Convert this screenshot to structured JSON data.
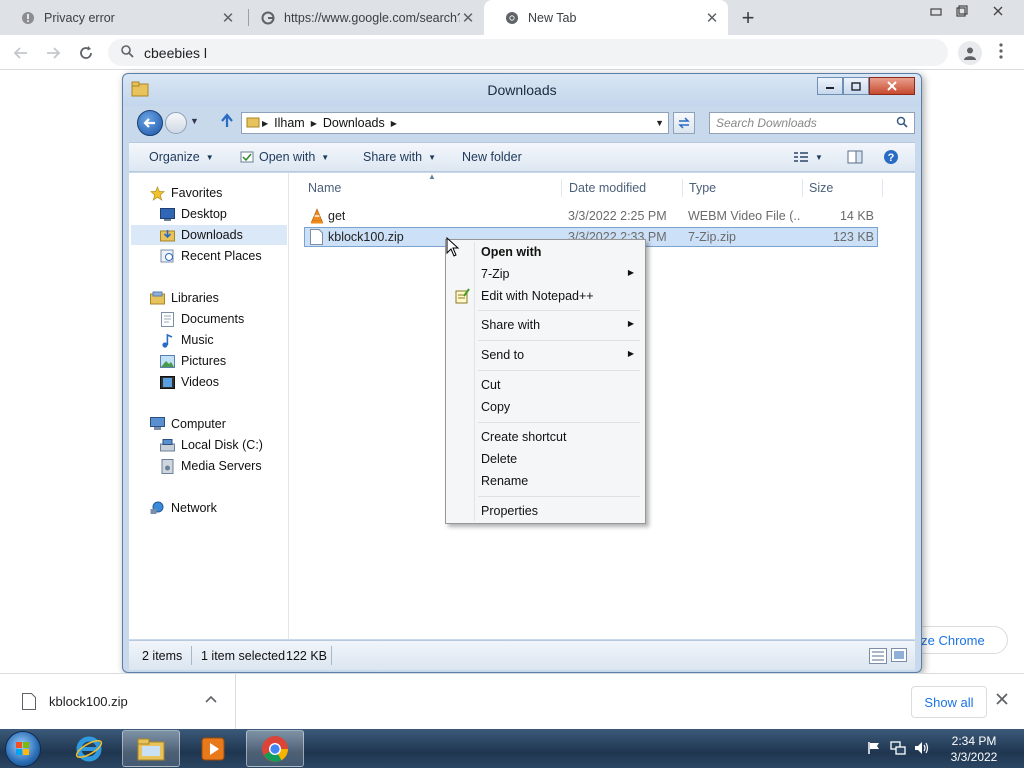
{
  "browser": {
    "tabs": [
      {
        "label": "Privacy error",
        "icon": "warning-icon"
      },
      {
        "label": "https://www.google.com/search?",
        "icon": "google-icon"
      },
      {
        "label": "New Tab",
        "icon": "chrome-icon"
      }
    ],
    "new_tab_symbol": "+",
    "close_symbol": "✕",
    "omnibox_text": "cbeebies l",
    "customize_label": "nize Chrome"
  },
  "explorer": {
    "title": "Downloads",
    "path": [
      "Ilham",
      "Downloads"
    ],
    "search_placeholder": "Search Downloads",
    "commands": {
      "organize": "Organize",
      "open_with": "Open with",
      "share_with": "Share with",
      "new_folder": "New folder"
    },
    "nav": {
      "favorites": "Favorites",
      "desktop": "Desktop",
      "downloads": "Downloads",
      "recent_places": "Recent Places",
      "libraries": "Libraries",
      "documents": "Documents",
      "music": "Music",
      "pictures": "Pictures",
      "videos": "Videos",
      "computer": "Computer",
      "local_disk": "Local Disk (C:)",
      "media_servers": "Media Servers",
      "network": "Network"
    },
    "columns": {
      "name": "Name",
      "date": "Date modified",
      "type": "Type",
      "size": "Size"
    },
    "files": [
      {
        "name": "get",
        "date": "3/3/2022 2:25 PM",
        "type": "WEBM Video File (...",
        "size": "14 KB",
        "icon": "vlc-cone-icon"
      },
      {
        "name": "kblock100.zip",
        "date": "3/3/2022 2:33 PM",
        "type": "7-Zip.zip",
        "size": "123 KB",
        "icon": "zip-file-icon"
      }
    ],
    "status": {
      "items": "2 items",
      "selected": "1 item selected",
      "size": "122 KB"
    }
  },
  "context_menu": {
    "open_with": "Open with",
    "seven_zip": "7-Zip",
    "edit_notepad": "Edit with Notepad++",
    "share_with": "Share with",
    "send_to": "Send to",
    "cut": "Cut",
    "copy": "Copy",
    "create_shortcut": "Create shortcut",
    "delete": "Delete",
    "rename": "Rename",
    "properties": "Properties"
  },
  "download_shelf": {
    "file_name": "kblock100.zip",
    "show_all": "Show all"
  },
  "taskbar": {
    "time": "2:34 PM",
    "date": "3/3/2022"
  },
  "colors": {
    "accent": "#1a73e8",
    "selection": "#cce0f7",
    "taskbar": "#1f3650"
  }
}
